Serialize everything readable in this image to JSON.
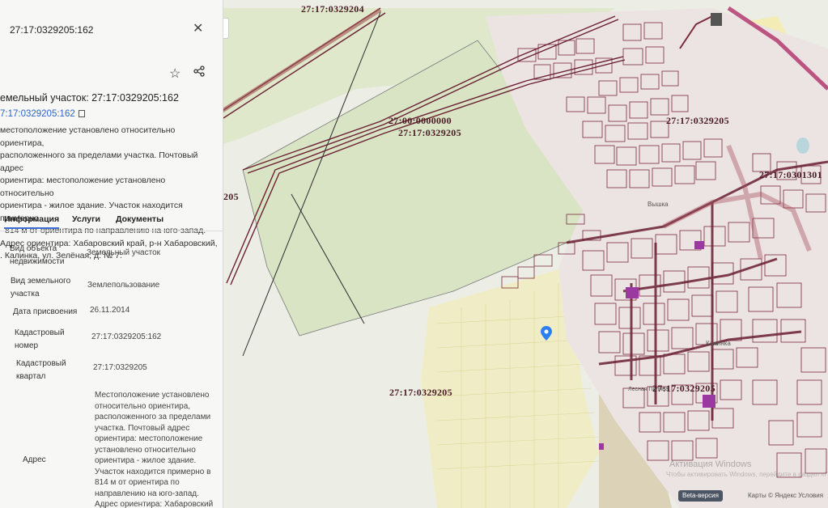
{
  "map": {
    "cadastral_labels": [
      "27:17:0329204",
      "27:00:0000000",
      "27:17:0329205",
      "27:17:0329205",
      "27:17:0301301",
      "205",
      "27:17:0329205",
      "27:17:0329205"
    ],
    "place_labels": [
      "Вышка",
      "Калинка",
      "Лесная Поляна"
    ],
    "beta_label": "Beta-версия",
    "copyright": "Карты © Яндекс  Условия",
    "watermark_line1": "Активация Windows",
    "watermark_line2": "Чтобы активировать Windows, перейдите в раздел «Параметры»."
  },
  "sidebar": {
    "search_title": "27:17:0329205:162",
    "object_title": "емельный участок: 27:17:0329205:162",
    "object_link": "7:17:0329205:162",
    "description_lines": [
      "местоположение установлено относительно ориентира,",
      "расположенного за пределами участка. Почтовый адрес",
      "ориентира: местоположение установлено относительно",
      "ориентира - жилое здание. Участок находится примерно",
      "814 м от ориентира по направлению на юго-запад.",
      "Адрес ориентира: Хабаровский край, р-н Хабаровский,",
      ". Калинка, ул. Зелёная, д. № 7."
    ],
    "tabs": [
      "Информация",
      "Услуги",
      "Документы"
    ],
    "rows": [
      {
        "label": "Вид объекта\nнедвижимости",
        "value": "Земельный участок"
      },
      {
        "label": "Вид земельного\nучастка",
        "value": "Землепользование"
      },
      {
        "label": "Дата присвоения",
        "value": "26.11.2014"
      },
      {
        "label": "Кадастровый\nномер",
        "value": "27:17:0329205:162"
      },
      {
        "label": "Кадастровый\nквартал",
        "value": "27:17:0329205"
      },
      {
        "label": "Адрес",
        "value": "Местоположение установлено\nотносительно ориентира,\nрасположенного за пределами\nучастка. Почтовый адрес\nориентира: местоположение\nустановлено относительно\nориентира - жилое здание.\nУчасток находится примерно в\n814 м от ориентира по\nнаправлению на юго-запад.\nАдрес ориентира: Хабаровский"
      }
    ]
  },
  "colors": {
    "parcel_line": "#7a2a3c",
    "road_stroke": "#6a1f33",
    "settlement_fill": "#eee6e6",
    "yellow_zone": "#f3ecb5",
    "green_zone": "#d9e5c6",
    "accent": "#3b6dd6",
    "marker": "#2d7ff0"
  },
  "icons": {
    "close": "close-icon",
    "star": "star-icon",
    "share": "share-icon",
    "copy": "copy-icon",
    "collapse": "chevron-left-icon",
    "marker": "map-pin-icon"
  }
}
